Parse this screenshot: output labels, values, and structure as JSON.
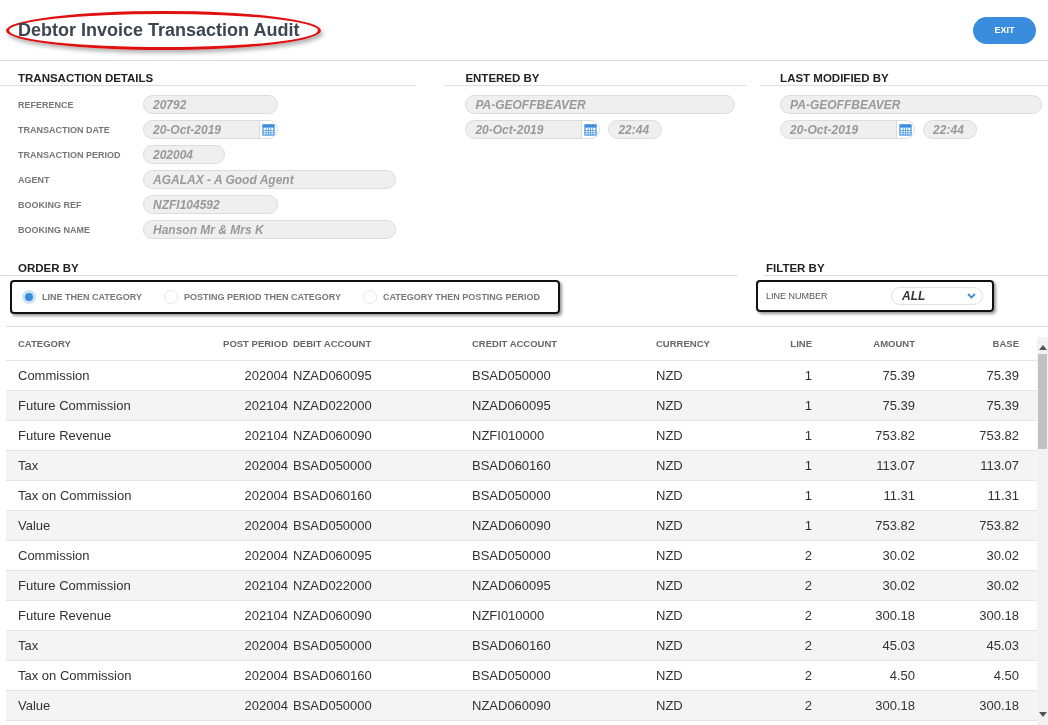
{
  "title": {
    "text": "Debtor Invoice Transaction Audit",
    "highlighted": true
  },
  "exit_button": "EXIT",
  "transaction_details": {
    "heading": "TRANSACTION DETAILS",
    "fields": [
      {
        "label": "REFERENCE",
        "value": "20792",
        "kind": "short"
      },
      {
        "label": "TRANSACTION DATE",
        "value": "20-Oct-2019",
        "kind": "date"
      },
      {
        "label": "TRANSACTION PERIOD",
        "value": "202004",
        "kind": "tiny"
      },
      {
        "label": "AGENT",
        "value": "AGALAX - A Good Agent",
        "kind": "long"
      },
      {
        "label": "BOOKING REF",
        "value": "NZFI104592",
        "kind": "short"
      },
      {
        "label": "BOOKING NAME",
        "value": "Hanson Mr & Mrs K",
        "kind": "long"
      }
    ]
  },
  "entered_by": {
    "heading": "ENTERED BY",
    "user": "PA-GEOFFBEAVER",
    "date": "20-Oct-2019",
    "time": "22:44"
  },
  "last_modified_by": {
    "heading": "LAST MODIFIED BY",
    "user": "PA-GEOFFBEAVER",
    "date": "20-Oct-2019",
    "time": "22:44"
  },
  "order_by": {
    "heading": "ORDER BY",
    "highlighted": true,
    "options": [
      {
        "label": "LINE THEN CATEGORY",
        "selected": true
      },
      {
        "label": "POSTING PERIOD THEN CATEGORY",
        "selected": false
      },
      {
        "label": "CATEGORY THEN POSTING PERIOD",
        "selected": false
      }
    ]
  },
  "filter_by": {
    "heading": "FILTER BY",
    "highlighted": true,
    "label": "LINE NUMBER",
    "value": "ALL"
  },
  "table": {
    "columns": [
      "CATEGORY",
      "POST PERIOD",
      "DEBIT ACCOUNT",
      "CREDIT ACCOUNT",
      "CURRENCY",
      "LINE",
      "AMOUNT",
      "BASE"
    ],
    "rows": [
      [
        "Commission",
        "202004",
        "NZAD060095",
        "BSAD050000",
        "NZD",
        "1",
        "75.39",
        "75.39"
      ],
      [
        "Future Commission",
        "202104",
        "NZAD022000",
        "NZAD060095",
        "NZD",
        "1",
        "75.39",
        "75.39"
      ],
      [
        "Future Revenue",
        "202104",
        "NZAD060090",
        "NZFI010000",
        "NZD",
        "1",
        "753.82",
        "753.82"
      ],
      [
        "Tax",
        "202004",
        "BSAD050000",
        "BSAD060160",
        "NZD",
        "1",
        "113.07",
        "113.07"
      ],
      [
        "Tax on Commission",
        "202004",
        "BSAD060160",
        "BSAD050000",
        "NZD",
        "1",
        "11.31",
        "11.31"
      ],
      [
        "Value",
        "202004",
        "BSAD050000",
        "NZAD060090",
        "NZD",
        "1",
        "753.82",
        "753.82"
      ],
      [
        "Commission",
        "202004",
        "NZAD060095",
        "BSAD050000",
        "NZD",
        "2",
        "30.02",
        "30.02"
      ],
      [
        "Future Commission",
        "202104",
        "NZAD022000",
        "NZAD060095",
        "NZD",
        "2",
        "30.02",
        "30.02"
      ],
      [
        "Future Revenue",
        "202104",
        "NZAD060090",
        "NZFI010000",
        "NZD",
        "2",
        "300.18",
        "300.18"
      ],
      [
        "Tax",
        "202004",
        "BSAD050000",
        "BSAD060160",
        "NZD",
        "2",
        "45.03",
        "45.03"
      ],
      [
        "Tax on Commission",
        "202004",
        "BSAD060160",
        "BSAD050000",
        "NZD",
        "2",
        "4.50",
        "4.50"
      ],
      [
        "Value",
        "202004",
        "BSAD050000",
        "NZAD060090",
        "NZD",
        "2",
        "300.18",
        "300.18"
      ]
    ]
  }
}
